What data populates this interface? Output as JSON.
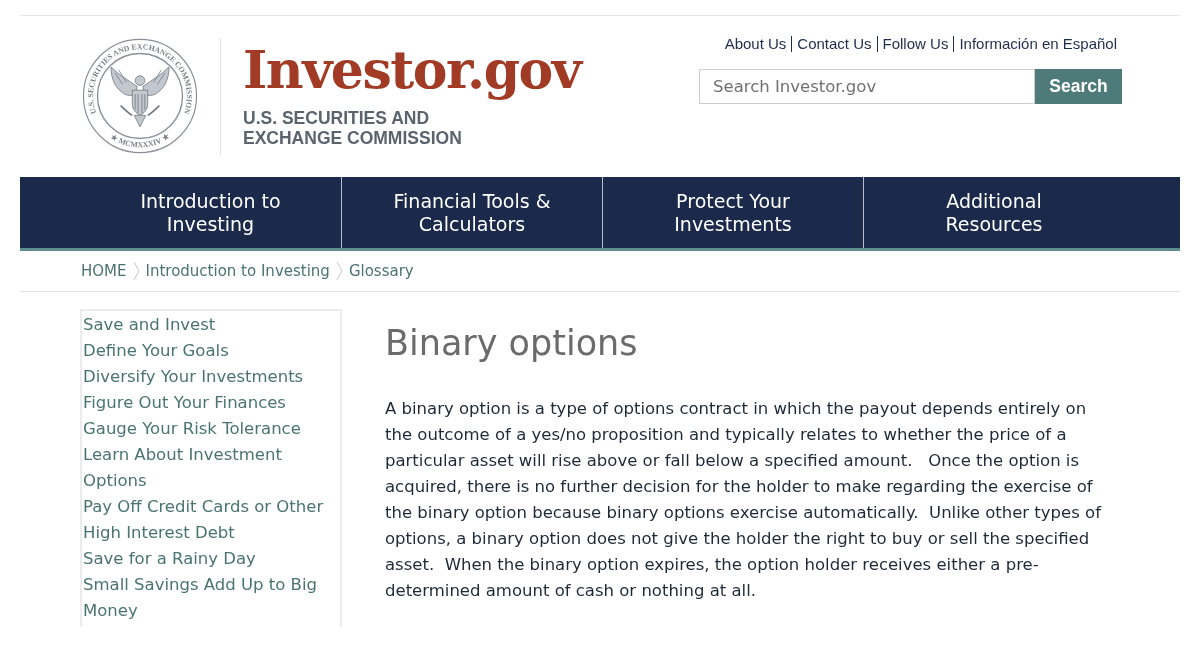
{
  "header": {
    "seal_text": "U.S. SECURITIES AND EXCHANGE COMMISSION",
    "seal_year": "★ MCMXXXIV ★",
    "site_name": "Investor.gov",
    "agency_name": "U.S. SECURITIES AND\nEXCHANGE COMMISSION"
  },
  "top_links": [
    "About Us",
    "Contact Us",
    "Follow Us",
    "Información en Español"
  ],
  "search": {
    "placeholder": "Search Investor.gov",
    "button": "Search"
  },
  "nav": [
    {
      "label": "Introduction to\nInvesting"
    },
    {
      "label": "Financial Tools &\nCalculators"
    },
    {
      "label": "Protect Your\nInvestments"
    },
    {
      "label": "Additional\nResources"
    }
  ],
  "breadcrumb": [
    "HOME",
    "Introduction to Investing",
    "Glossary"
  ],
  "sidebar": {
    "items": [
      "Save and Invest",
      "Define Your Goals",
      "Diversify Your Investments",
      "Figure Out Your Finances",
      "Gauge Your Risk Tolerance",
      "Learn About Investment Options",
      "Pay Off Credit Cards or Other High Interest Debt",
      "Save for a Rainy Day",
      "Small Savings Add Up to Big Money"
    ]
  },
  "article": {
    "title": "Binary options",
    "body": "A binary option is a type of options contract in which the payout depends entirely on the outcome of a yes/no proposition and typically relates to whether the price of a particular asset will rise above or fall below a specified amount.   Once the option is acquired, there is no further decision for the holder to make regarding the exercise of the binary option because binary options exercise automatically.  Unlike other types of options, a binary option does not give the holder the right to buy or sell the specified asset.  When the binary option expires, the option holder receives either a pre-determined amount of cash or nothing at all."
  }
}
